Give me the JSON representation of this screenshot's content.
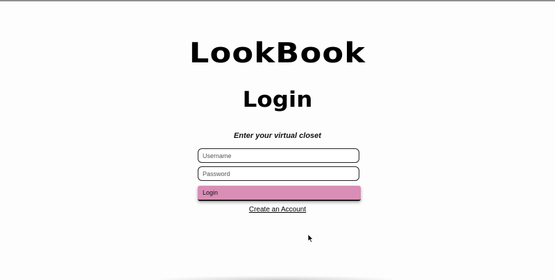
{
  "app": {
    "logo": "LookBook"
  },
  "login": {
    "heading": "Login",
    "tagline": "Enter your virtual closet",
    "username_placeholder": "Username",
    "password_placeholder": "Password",
    "login_button_label": "Login",
    "create_account_link": "Create an Account",
    "button_color": "#d98eb6"
  },
  "icons": {
    "cursor": "mouse-pointer-icon"
  }
}
